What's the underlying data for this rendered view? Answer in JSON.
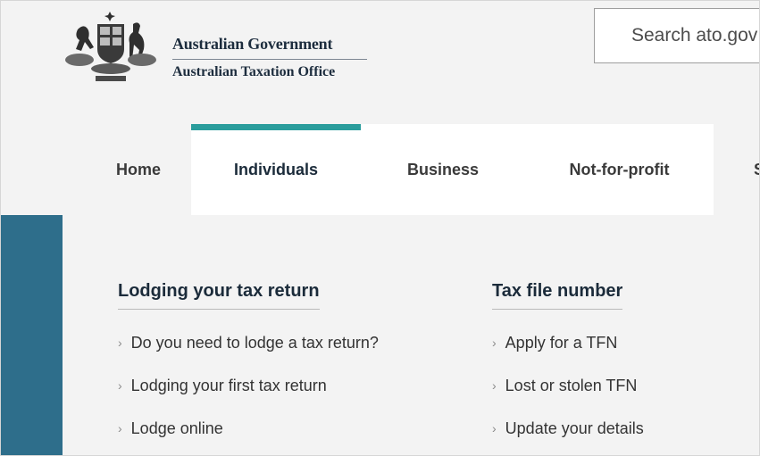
{
  "header": {
    "gov_line1": "Australian Government",
    "gov_line2": "Australian Taxation Office",
    "search_text": "Search ato.gov"
  },
  "nav": {
    "items": [
      {
        "label": "Home"
      },
      {
        "label": "Individuals"
      },
      {
        "label": "Business"
      },
      {
        "label": "Not-for-profit"
      },
      {
        "label": "S"
      }
    ],
    "active": "Individuals"
  },
  "sections": {
    "lodging": {
      "heading": "Lodging your tax return",
      "links": [
        "Do you need to lodge a tax return?",
        "Lodging your first tax return",
        "Lodge online"
      ]
    },
    "tfn": {
      "heading": "Tax file number",
      "links": [
        "Apply for a TFN",
        "Lost or stolen TFN",
        "Update your details"
      ]
    }
  },
  "colors": {
    "accent_teal": "#2a9d9c",
    "sidebar_blue": "#2e6e8b",
    "heading_navy": "#1b2b3a"
  },
  "icons": {
    "crest": "coat-of-arms-icon",
    "chevron": "chevron-right-icon"
  }
}
